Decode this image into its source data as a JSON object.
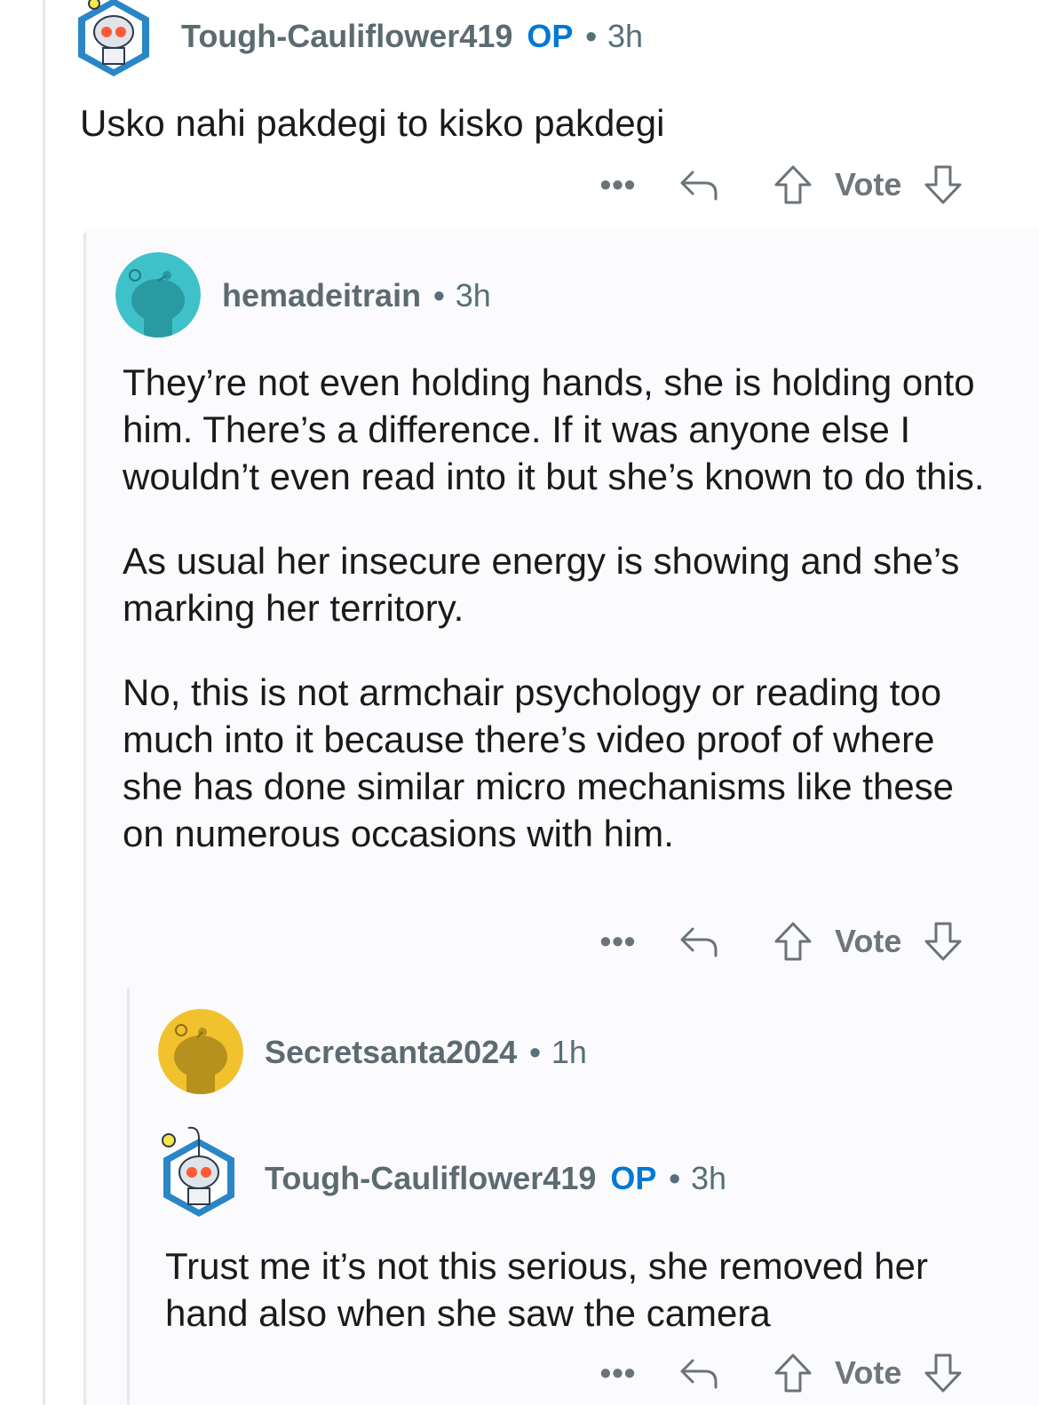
{
  "comments": [
    {
      "author": "Tough-Cauliflower419",
      "op_badge": "OP",
      "separator": "•",
      "age": "3h",
      "avatar_icon": "snoo-robot-avatar-icon",
      "paragraphs": [
        "Usko nahi pakdegi to kisko pakdegi"
      ],
      "actions": {
        "more_label": "•••",
        "vote_label": "Vote"
      }
    },
    {
      "author": "hemadeitrain",
      "separator": "•",
      "age": "3h",
      "avatar_icon": "snoo-teal-avatar-icon",
      "avatar_color": "#3fc1c9",
      "paragraphs": [
        "They’re not even holding hands, she is holding onto him. There’s a difference. If it was anyone else I wouldn’t even read into it but she’s known to do this.",
        "As usual her insecure energy is showing and she’s marking her territory.",
        "No, this is not armchair psychology or reading too much into it because there’s video proof of where she has done similar micro mechanisms like these on numerous occasions with him."
      ],
      "actions": {
        "more_label": "•••",
        "vote_label": "Vote"
      }
    },
    {
      "author": "Secretsanta2024",
      "separator": "•",
      "age": "1h",
      "avatar_icon": "snoo-yellow-avatar-icon",
      "avatar_color": "#f2c12e"
    },
    {
      "author": "Tough-Cauliflower419",
      "op_badge": "OP",
      "separator": "•",
      "age": "3h",
      "avatar_icon": "snoo-robot-avatar-icon",
      "paragraphs": [
        "Trust me it’s not this serious, she removed her hand also when she saw the camera"
      ],
      "actions": {
        "more_label": "•••",
        "vote_label": "Vote"
      }
    }
  ],
  "colors": {
    "op": "#0079d3",
    "username": "#5c6b70",
    "text": "#1a1a1b",
    "thread_line": "#e8e8ea"
  }
}
